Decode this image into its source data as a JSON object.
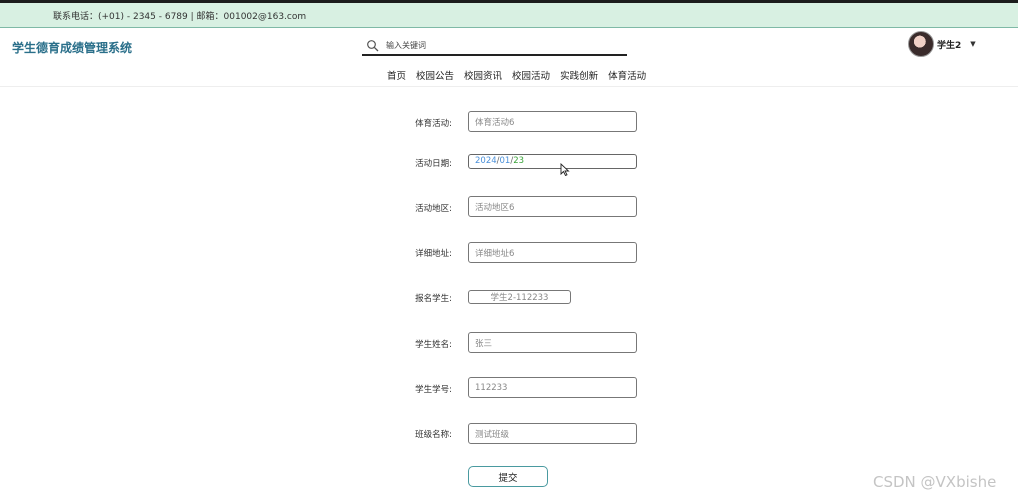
{
  "topbar": {
    "contact": "联系电话：(+01) - 2345 - 6789 | 邮箱：001002@163.com"
  },
  "header": {
    "brand": "学生德育成绩管理系统",
    "search_placeholder": "输入关键词",
    "user_name": "学生2"
  },
  "nav": [
    "首页",
    "校园公告",
    "校园资讯",
    "校园活动",
    "实践创新",
    "体育活动"
  ],
  "form": {
    "sport_label": "体育活动:",
    "sport_value": "体育活动6",
    "date_label": "活动日期:",
    "date_year": "2024",
    "date_month": "01",
    "date_day": "23",
    "area_label": "活动地区:",
    "area_value": "活动地区6",
    "address_label": "详细地址:",
    "address_value": "详细地址6",
    "signup_label": "报名学生:",
    "signup_value": "学生2-112233",
    "student_name_label": "学生姓名:",
    "student_name_value": "张三",
    "student_no_label": "学生学号:",
    "student_no_value": "112233",
    "class_label": "班级名称:",
    "class_value": "测试班级",
    "submit_label": "提交"
  },
  "watermark": "CSDN @VXbishe",
  "colors": {
    "topbar_bg": "#d8f0e2",
    "brand": "#2a6f8a",
    "button_border": "#4a9aa0"
  }
}
